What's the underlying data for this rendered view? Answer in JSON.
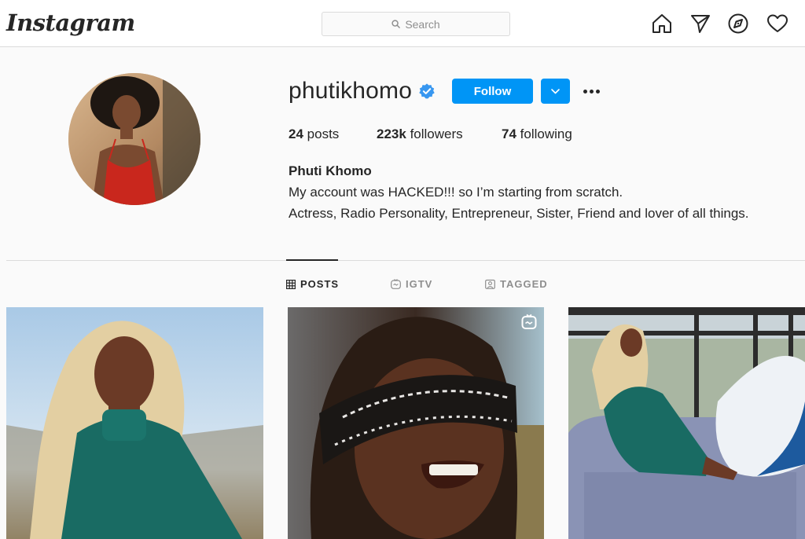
{
  "app": {
    "logo_text": "Instagram"
  },
  "search": {
    "placeholder": "Search"
  },
  "nav": {
    "icons": [
      "home-icon",
      "direct-icon",
      "explore-icon",
      "activity-icon"
    ]
  },
  "profile": {
    "username": "phutikhomo",
    "verified": true,
    "follow_label": "Follow",
    "stats": {
      "posts_count": "24",
      "posts_label": "posts",
      "followers_count": "223k",
      "followers_label": "followers",
      "following_count": "74",
      "following_label": "following"
    },
    "full_name": "Phuti Khomo",
    "bio_lines": [
      "My account was HACKED!!! so I’m starting from scratch.",
      "Actress, Radio Personality, Entrepreneur, Sister, Friend and lover of all things."
    ]
  },
  "tabs": [
    {
      "label": "POSTS",
      "icon": "grid-icon",
      "active": true
    },
    {
      "label": "IGTV",
      "icon": "igtv-icon",
      "active": false
    },
    {
      "label": "TAGGED",
      "icon": "tagged-icon",
      "active": false
    }
  ],
  "posts": [
    {
      "type": "image"
    },
    {
      "type": "igtv-video"
    },
    {
      "type": "image"
    }
  ],
  "colors": {
    "accent": "#0095f6",
    "verified": "#3897f0"
  }
}
